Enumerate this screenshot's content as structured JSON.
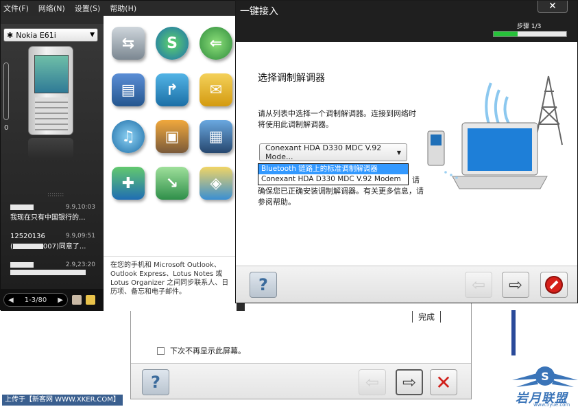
{
  "app_window": {
    "menu": [
      "文件(F)",
      "网络(N)",
      "设置(S)",
      "帮助(H)"
    ],
    "device_name": "Nokia E61i",
    "side_counter": "0",
    "messages": [
      {
        "sender": "",
        "time": "9.9,10:03",
        "preview": "我现在只有中国银行的..."
      },
      {
        "sender": "12520136",
        "time": "9.9,09:51",
        "preview": "007)同意了..."
      },
      {
        "sender": "",
        "time": "2.9,23:20",
        "preview": ""
      }
    ],
    "pager": "1-3/80",
    "description": "在您的手机和 Microsoft Outlook、Outlook Express、Lotus Notes 或 Lotus Organizer 之间同步联系人、日历项、备忘和电子邮件。",
    "icons": [
      "file-transfer-icon",
      "sync-icon",
      "internet-connect-icon",
      "backup-icon",
      "install-apps-icon",
      "messages-icon",
      "music-icon",
      "photos-icon",
      "video-icon",
      "contacts-icon",
      "download-icon",
      "maps-icon"
    ]
  },
  "wizard": {
    "title": "一键接入",
    "close_label": "✕",
    "step_label": "步骤 1/3",
    "step_progress": 0.33,
    "heading": "选择调制解调器",
    "intro": "请从列表中选择一个调制解调器。连接到网络时将使用此调制解调器。",
    "selected_modem": "Conexant HDA D330 MDC V.92 Mode...",
    "modem_options": [
      "Bluetooth 链路上的标准调制解调器",
      "Conexant HDA D330 MDC V.92 Modem"
    ],
    "note_tail": "请",
    "note": "确保您已正确安装调制解调器。有关更多信息，请参阅帮助。"
  },
  "back_dialog": {
    "finish_label": "完成",
    "checkbox_label": "下次不再显示此屏幕。"
  },
  "footer": {
    "upload_note": "上传于【新客网 WWW.XKER.COM】",
    "watermark": "岩月联盟",
    "watermark_sub": "www.5yue.com"
  }
}
